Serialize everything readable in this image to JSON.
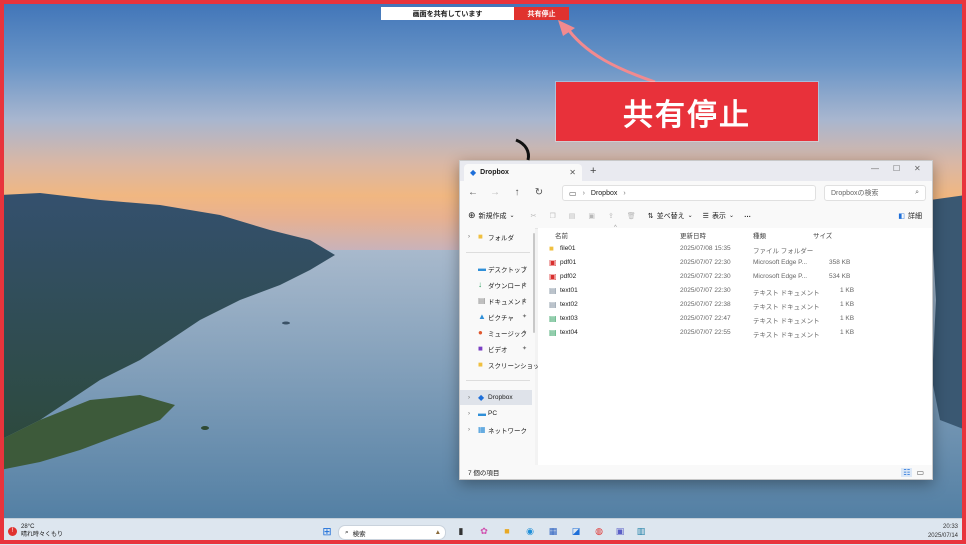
{
  "share_bar": {
    "text": "画面を共有しています",
    "stop_label": "共有停止"
  },
  "callout": {
    "label": "共有停止"
  },
  "colors": {
    "accent_red": "#e8313a",
    "folder_yellow": "#f0c040",
    "dropbox_blue": "#1e6fd9"
  },
  "explorer": {
    "tab_title": "Dropbox",
    "tab_icon": "dropbox-icon",
    "address": {
      "crumbs": [
        "Dropbox"
      ]
    },
    "search_placeholder": "Dropboxの検索",
    "toolbar": {
      "new": "新規作成",
      "sort": "並べ替え",
      "view": "表示",
      "more": "…",
      "details": "詳細"
    },
    "sidebar": {
      "items": [
        {
          "label": "フォルダ",
          "icon": "folder-icon"
        },
        {
          "label": "デスクトップ",
          "icon": "desktop-icon"
        },
        {
          "label": "ダウンロード",
          "icon": "download-icon"
        },
        {
          "label": "ドキュメント",
          "icon": "document-icon"
        },
        {
          "label": "ピクチャ",
          "icon": "picture-icon"
        },
        {
          "label": "ミュージック",
          "icon": "music-icon"
        },
        {
          "label": "ビデオ",
          "icon": "video-icon"
        },
        {
          "label": "スクリーンショット",
          "icon": "folder-icon"
        },
        {
          "label": "Dropbox",
          "icon": "dropbox-icon"
        },
        {
          "label": "PC",
          "icon": "pc-icon"
        },
        {
          "label": "ネットワーク",
          "icon": "network-icon"
        }
      ]
    },
    "columns": [
      "名前",
      "更新日時",
      "種類",
      "サイズ"
    ],
    "files": [
      {
        "name": "file01",
        "date": "2025/07/08 15:35",
        "type": "ファイル フォルダー",
        "size": "",
        "icon": "folder-icon"
      },
      {
        "name": "pdf01",
        "date": "2025/07/07 22:30",
        "type": "Microsoft Edge P...",
        "size": "358 KB",
        "icon": "pdf-icon"
      },
      {
        "name": "pdf02",
        "date": "2025/07/07 22:30",
        "type": "Microsoft Edge P...",
        "size": "534 KB",
        "icon": "pdf-icon"
      },
      {
        "name": "text01",
        "date": "2025/07/07 22:30",
        "type": "テキスト ドキュメント",
        "size": "1 KB",
        "icon": "text-file-icon"
      },
      {
        "name": "text02",
        "date": "2025/07/07 22:38",
        "type": "テキスト ドキュメント",
        "size": "1 KB",
        "icon": "text-file-icon"
      },
      {
        "name": "text03",
        "date": "2025/07/07 22:47",
        "type": "テキスト ドキュメント",
        "size": "1 KB",
        "icon": "text-file-icon"
      },
      {
        "name": "text04",
        "date": "2025/07/07 22:55",
        "type": "テキスト ドキュメント",
        "size": "1 KB",
        "icon": "text-file-icon"
      }
    ],
    "status": "7 個の項目"
  },
  "taskbar": {
    "weather_temp": "28°C",
    "weather_desc": "晴れ時々くもり",
    "search_label": "検索",
    "clock_time": "20:33",
    "clock_date": "2025/07/14"
  }
}
